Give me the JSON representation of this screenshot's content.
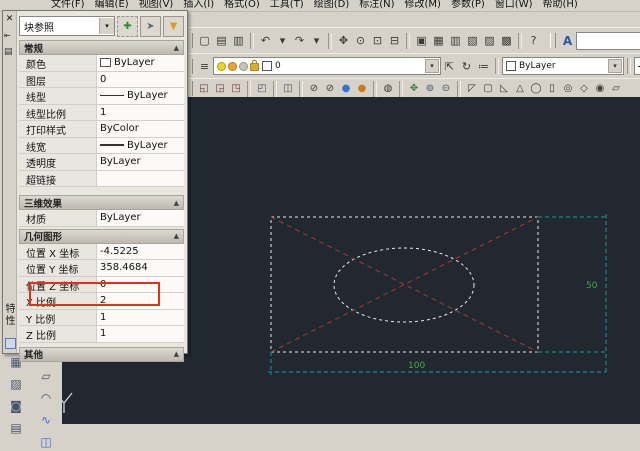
{
  "menu_bar": {
    "items": [
      "文件(F)",
      "编辑(E)",
      "视图(V)",
      "插入(I)",
      "格式(O)",
      "工具(T)",
      "绘图(D)",
      "标注(N)",
      "修改(M)",
      "参数(P)",
      "窗口(W)",
      "帮助(H)"
    ]
  },
  "toolbars": {
    "standard": {
      "icons": [
        {
          "n": "new-file",
          "g": "▢"
        },
        {
          "n": "open-file",
          "g": "▤"
        },
        {
          "n": "plot",
          "g": "▥"
        },
        {
          "s": true
        },
        {
          "n": "undo",
          "g": "↶"
        },
        {
          "n": "undo-dropdown",
          "g": "▾"
        },
        {
          "n": "redo",
          "g": "↷"
        },
        {
          "n": "redo-dropdown",
          "g": "▾"
        },
        {
          "s": true
        },
        {
          "n": "pan",
          "g": "✥"
        },
        {
          "n": "zoom-realtime",
          "g": "⊙"
        },
        {
          "n": "zoom-window",
          "g": "⊡"
        },
        {
          "n": "zoom-previous",
          "g": "⊟"
        },
        {
          "s": true
        },
        {
          "n": "properties-palette",
          "g": "▣"
        },
        {
          "n": "design-center",
          "g": "▦"
        },
        {
          "n": "tool-palettes",
          "g": "▥"
        },
        {
          "n": "sheet-set-manager",
          "g": "▧"
        },
        {
          "n": "markup-set-manager",
          "g": "▨"
        },
        {
          "n": "quick-calc",
          "g": "▩"
        },
        {
          "s": true
        },
        {
          "n": "help",
          "g": "?"
        }
      ]
    },
    "styles": {
      "text_style_icon": "A",
      "text_style_value": "",
      "dropdown_arrow": "▾",
      "partial_icon": "▰"
    },
    "layers": {
      "manager_icon": "≡",
      "layer_name": "0",
      "dropdown_arrow": "▾",
      "icons": [
        {
          "n": "make-object-layer-current",
          "g": "⇱"
        },
        {
          "n": "layer-previous",
          "g": "↻"
        },
        {
          "n": "layer-states",
          "g": "≔"
        }
      ]
    },
    "properties_bar": {
      "color_value": "ByLayer",
      "dropdown_arrow": "▾"
    },
    "modeling_row": {
      "icons": [
        {
          "n": "constraint-x",
          "g": "◱",
          "c": "#6b4434"
        },
        {
          "n": "constraint-y",
          "g": "◲",
          "c": "#6b4434"
        },
        {
          "n": "constraint-z",
          "g": "◳",
          "c": "#6b4434"
        },
        {
          "s": true
        },
        {
          "n": "auto-constrain",
          "g": "◰",
          "c": "#44546a"
        },
        {
          "s": true
        },
        {
          "n": "solid-subtract",
          "g": "◫",
          "c": "#44546a"
        },
        {
          "s": true
        },
        {
          "n": "visual-style-2d-wireframe",
          "g": "⊘"
        },
        {
          "n": "visual-style-3d-wireframe",
          "g": "⊘"
        },
        {
          "n": "visual-style-realistic",
          "g": "●",
          "c": "#3a6fd8"
        },
        {
          "n": "visual-style-conceptual",
          "g": "●",
          "c": "#cc7a22"
        },
        {
          "s": true
        },
        {
          "n": "manage-visual-styles",
          "g": "◍"
        },
        {
          "s": true
        },
        {
          "n": "3d-move",
          "g": "✥",
          "c": "#3a7a3a"
        },
        {
          "n": "3d-rotate",
          "g": "⊚",
          "c": "#44546a"
        },
        {
          "n": "3d-align",
          "g": "⊝",
          "c": "#44546a"
        },
        {
          "s": true
        },
        {
          "n": "presspull",
          "g": "◸"
        },
        {
          "n": "box",
          "g": "▢"
        },
        {
          "n": "wedge",
          "g": "◺"
        },
        {
          "n": "pyramid",
          "g": "△"
        },
        {
          "n": "sphere",
          "g": "◯"
        },
        {
          "n": "cylinder",
          "g": "▯"
        },
        {
          "n": "torus",
          "g": "◎"
        },
        {
          "n": "polysolid",
          "g": "◇"
        },
        {
          "n": "helix",
          "g": "◉"
        },
        {
          "n": "planar-surface",
          "g": "▱"
        }
      ]
    },
    "left_modify_column": {
      "icons": [
        {
          "n": "hatch",
          "g": "▦"
        },
        {
          "n": "gradient",
          "g": "▨"
        },
        {
          "n": "region",
          "g": "◙"
        },
        {
          "n": "table",
          "g": "▤"
        }
      ]
    },
    "left_draw_column": {
      "icons": [
        {
          "n": "divide",
          "g": "#",
          "c": "#3a6fd8"
        },
        {
          "n": "polygon",
          "g": "▱"
        },
        {
          "n": "revision-cloud",
          "g": "◠"
        },
        {
          "n": "spline",
          "g": "∿",
          "c": "#3a6fd8"
        },
        {
          "n": "3d-solid",
          "g": "◫",
          "c": "#3a6fd8"
        }
      ]
    }
  },
  "palette": {
    "title": "特性",
    "close_glyph": "✕",
    "autohide_glyph": "⇤",
    "menu_glyph": "▤",
    "type_selector": "块参照",
    "dropdown_arrow": "▾",
    "tool_buttons": [
      {
        "name": "toggle-pickadd",
        "glyph": "✚",
        "color": "#2e8b2e"
      },
      {
        "name": "select-objects",
        "glyph": "➤",
        "color": "#5a6a7a"
      },
      {
        "name": "quick-select",
        "glyph": "▼",
        "color": "#d8a018"
      }
    ],
    "section_caret": "▲",
    "sections": [
      {
        "header": "常规",
        "rows": [
          {
            "label": "颜色",
            "value": "ByLayer"
          },
          {
            "label": "图层",
            "value": "0"
          },
          {
            "label": "线型",
            "value": "ByLayer"
          },
          {
            "label": "线型比例",
            "value": "1"
          },
          {
            "label": "打印样式",
            "value": "ByColor"
          },
          {
            "label": "线宽",
            "value": "ByLayer"
          },
          {
            "label": "透明度",
            "value": "ByLayer"
          },
          {
            "label": "超链接",
            "value": ""
          }
        ]
      },
      {
        "header": "三维效果",
        "rows": [
          {
            "label": "材质",
            "value": "ByLayer"
          }
        ]
      },
      {
        "header": "几何图形",
        "rows": [
          {
            "label": "位置 X 坐标",
            "value": "-4.5225"
          },
          {
            "label": "位置 Y 坐标",
            "value": "358.4684"
          },
          {
            "label": "位置 Z 坐标",
            "value": "0"
          },
          {
            "label": "X 比例",
            "value": "2",
            "highlight": true
          },
          {
            "label": "Y 比例",
            "value": "1"
          },
          {
            "label": "Z 比例",
            "value": "1"
          }
        ]
      },
      {
        "header": "其他",
        "rows": []
      }
    ],
    "highlight_color": "#e0301e"
  },
  "drawing": {
    "background": "#212830",
    "dim_width_label": "100",
    "dim_height_label": "50",
    "colors": {
      "block_outline": "#e9e9e9",
      "diagonals": "#93372f",
      "dimensions": "#129d9d",
      "dim_text": "#3fae3f",
      "ucs_icon": "#cfd4da"
    }
  }
}
